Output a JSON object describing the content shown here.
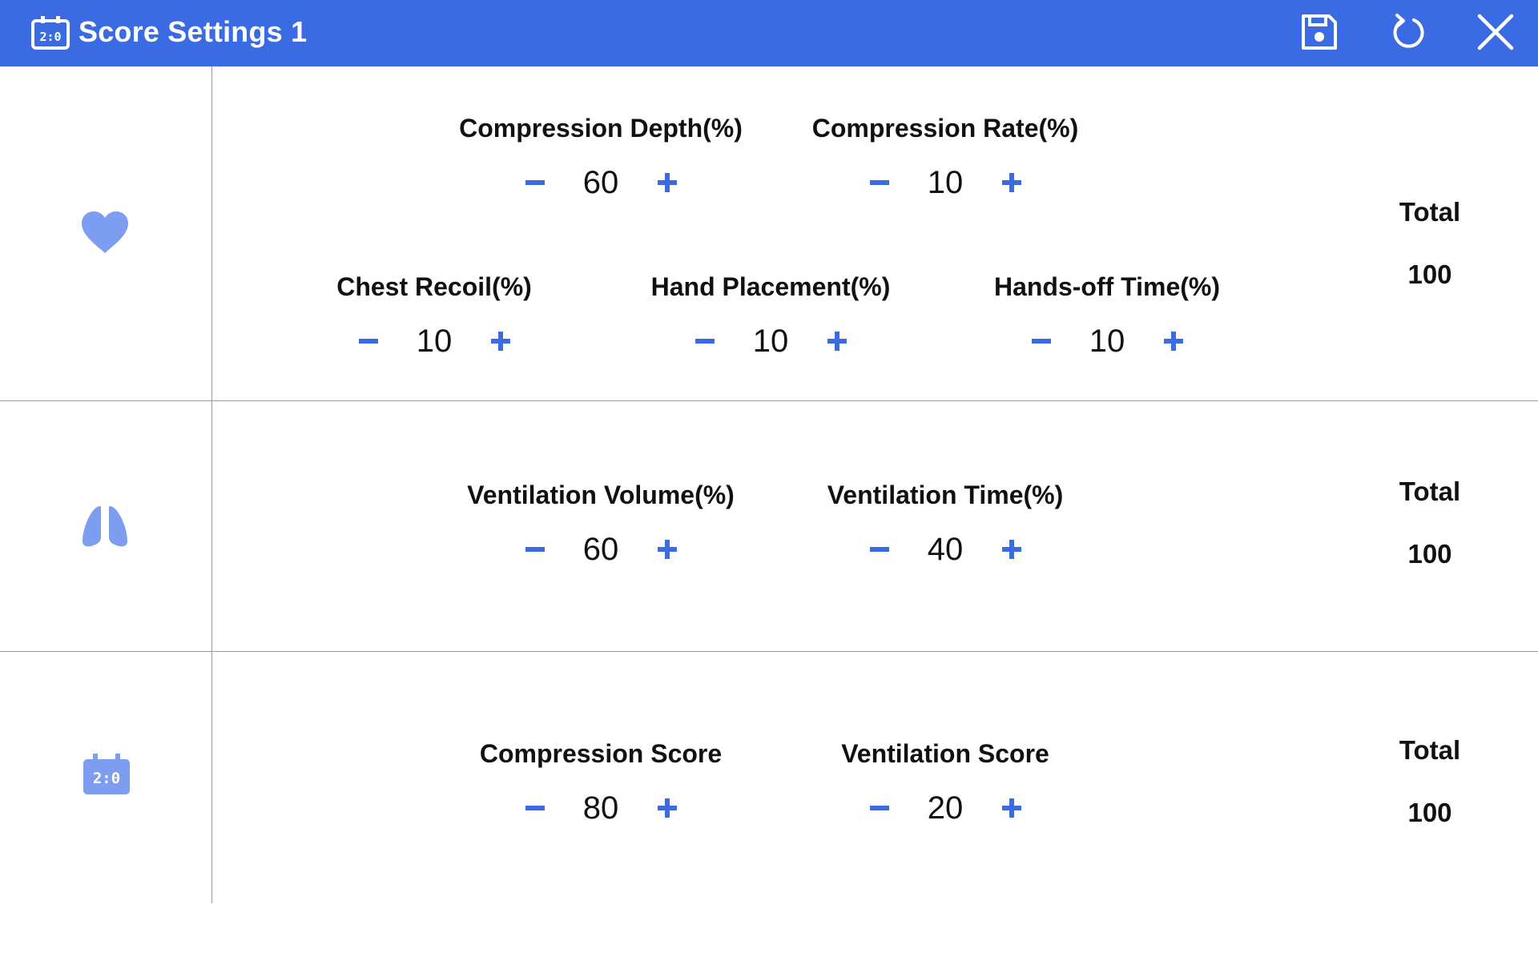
{
  "colors": {
    "accent": "#3a6be2",
    "icon_light": "#7d9df0",
    "divider": "#9a9a9a"
  },
  "window": {
    "title": "Score Settings 1",
    "title_icon": "scoreboard-icon"
  },
  "toolbar": {
    "save_icon": "save-icon",
    "reset_icon": "reset-icon",
    "close_icon": "close-icon"
  },
  "sections": [
    {
      "icon": "heart-icon",
      "controls": [
        {
          "label": "Compression Depth(%)",
          "value": "60"
        },
        {
          "label": "Compression Rate(%)",
          "value": "10"
        },
        {
          "label": "Chest Recoil(%)",
          "value": "10"
        },
        {
          "label": "Hand Placement(%)",
          "value": "10"
        },
        {
          "label": "Hands-off Time(%)",
          "value": "10"
        }
      ],
      "total_label": "Total",
      "total_value": "100"
    },
    {
      "icon": "lungs-icon",
      "controls": [
        {
          "label": "Ventilation Volume(%)",
          "value": "60"
        },
        {
          "label": "Ventilation Time(%)",
          "value": "40"
        }
      ],
      "total_label": "Total",
      "total_value": "100"
    },
    {
      "icon": "scoreboard-icon",
      "controls": [
        {
          "label": "Compression Score",
          "value": "80"
        },
        {
          "label": "Ventilation Score",
          "value": "20"
        }
      ],
      "total_label": "Total",
      "total_value": "100"
    }
  ]
}
